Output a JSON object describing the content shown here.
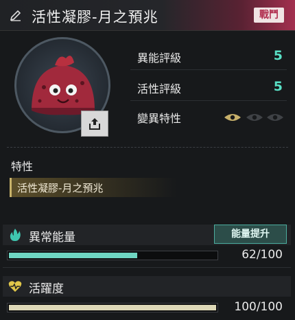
{
  "header": {
    "title": "活性凝膠-月之預兆",
    "tag": "戰鬥",
    "accent_color": "#a3304f",
    "edit_icon": "pencil-icon"
  },
  "portrait": {
    "subject": "red-jelly-creature-icon",
    "share_icon": "share-icon"
  },
  "stats": [
    {
      "label": "異能評級",
      "value": "5"
    },
    {
      "label": "活性評級",
      "value": "5"
    },
    {
      "label": "變異特性",
      "eyes_active": 1,
      "eyes_total": 3
    }
  ],
  "traits": {
    "title": "特性",
    "items": [
      "活性凝膠-月之預兆"
    ]
  },
  "energy": {
    "label": "異常能量",
    "icon": "flame-icon",
    "boost_label": "能量提升",
    "current": 62,
    "max": 100,
    "display": "62/100",
    "color": "#6fd6c2"
  },
  "vitality": {
    "label": "活躍度",
    "icon": "heart-pulse-icon",
    "current": 100,
    "max": 100,
    "display": "100/100",
    "color": "#ddd8b7"
  }
}
